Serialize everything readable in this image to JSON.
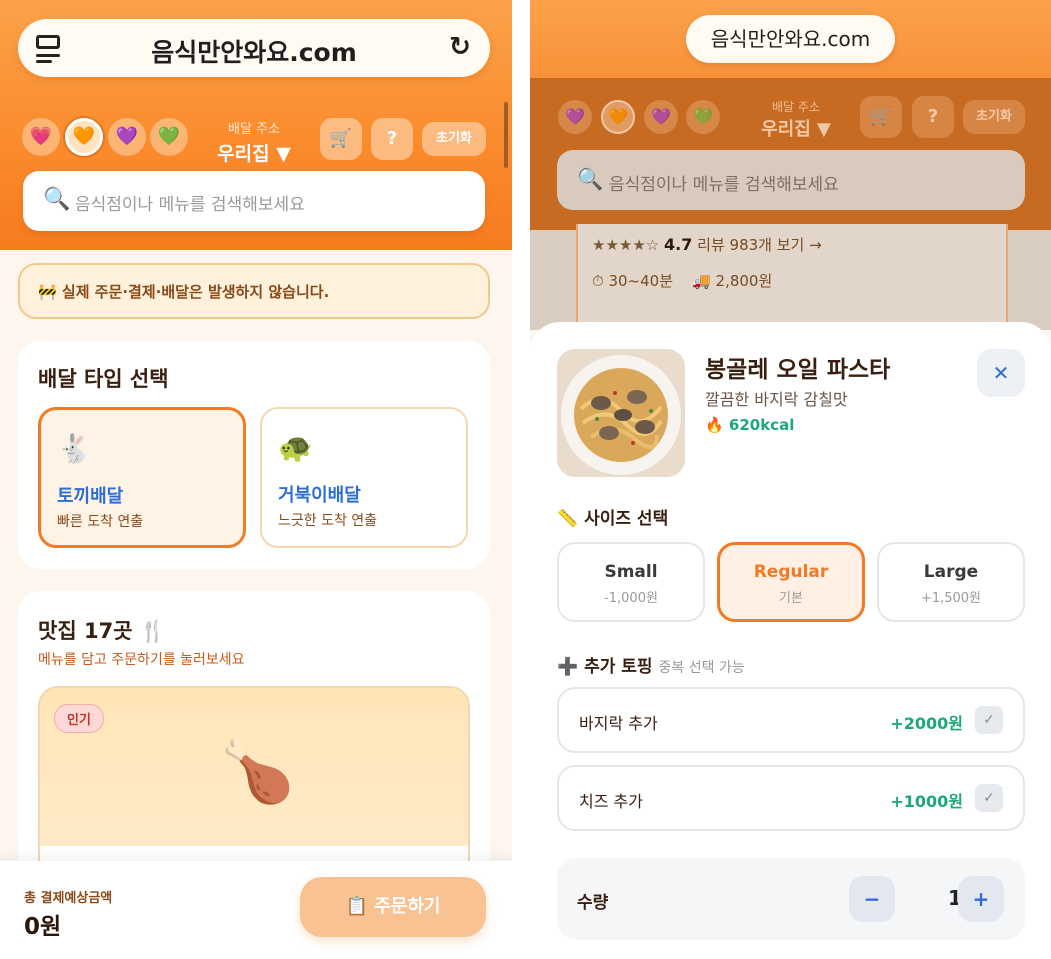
{
  "left": {
    "url": "음식만안와요.com",
    "themes": [
      "💗",
      "🧡",
      "💜",
      "💚"
    ],
    "address_label": "배달 주소",
    "address_value": "우리집 ▼",
    "cart_icon": "🛒",
    "help_label": "?",
    "reset_label": "초기화",
    "search_placeholder": "음식점이나 메뉴를 검색해보세요",
    "search_icon": "🔍",
    "notice": "🚧 실제 주문·결제·배달은 발생하지 않습니다.",
    "delivery": {
      "title": "배달 타입 선택",
      "options": [
        {
          "emoji": "🐇",
          "name": "토끼배달",
          "desc": "빠른 도착 연출"
        },
        {
          "emoji": "🐢",
          "name": "거북이배달",
          "desc": "느긋한 도착 연출"
        }
      ]
    },
    "restaurants": {
      "title": "맛집 17곳 🍴",
      "subtitle": "메뉴를 담고 주문하기를 눌러보세요",
      "badge": "인기",
      "food_emoji": "🍗"
    },
    "footer": {
      "total_label": "총 결제예상금액",
      "total_value": "0원",
      "order_button": "📋 주문하기"
    }
  },
  "right": {
    "url": "음식만안와요.com",
    "themes": [
      "💜",
      "🧡",
      "💜",
      "💚"
    ],
    "address_label": "배달 주소",
    "address_value": "우리집 ▼",
    "cart_icon": "🛒",
    "help_label": "?",
    "reset_label": "초기화",
    "search_placeholder": "음식점이나 메뉴를 검색해보세요",
    "search_icon": "🔍",
    "behind": {
      "stars": "★★★★☆",
      "rating": "4.7",
      "reviews": "리뷰 983개",
      "reviews_link": "보기 →",
      "time": "⏱ 30~40분",
      "fee": "🚚 2,800원"
    },
    "sheet": {
      "title": "봉골레 오일 파스타",
      "subtitle": "깔끔한 바지락 감칠맛",
      "kcal": "🔥 620kcal",
      "close_label": "✕",
      "size_title": "📏 사이즈 선택",
      "sizes": [
        {
          "name": "Small",
          "price": "-1,000원"
        },
        {
          "name": "Regular",
          "price": "기본"
        },
        {
          "name": "Large",
          "price": "+1,500원"
        }
      ],
      "selected_size": "Regular",
      "topping_title": "➕ 추가 토핑",
      "topping_hint": "중복 선택 가능",
      "toppings": [
        {
          "name": "바지락 추가",
          "price": "+2000원",
          "check": "✓"
        },
        {
          "name": "치즈 추가",
          "price": "+1000원",
          "check": "✓"
        }
      ],
      "quantity_label": "수량",
      "quantity_minus": "−",
      "quantity_value": "1",
      "quantity_plus": "+"
    }
  }
}
